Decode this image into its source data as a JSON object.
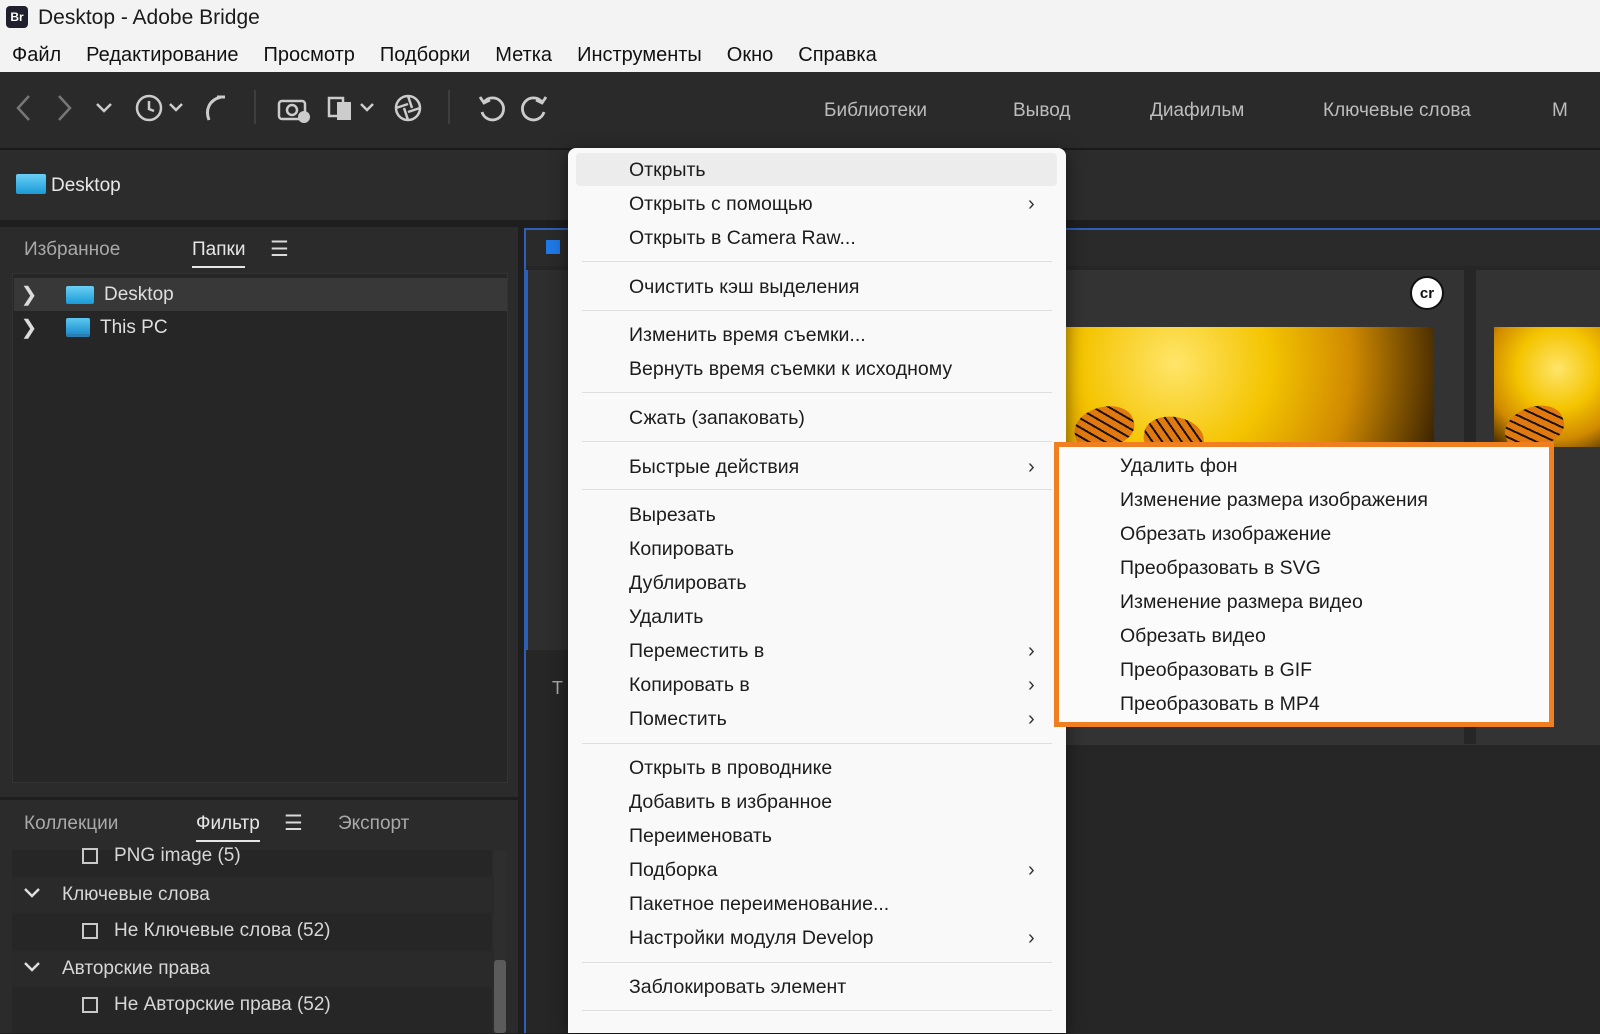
{
  "window": {
    "app_badge": "Br",
    "title": "Desktop - Adobe Bridge"
  },
  "menubar": [
    "Файл",
    "Редактирование",
    "Просмотр",
    "Подборки",
    "Метка",
    "Инструменты",
    "Окно",
    "Справка"
  ],
  "toolbar": {
    "icons": [
      "back-icon",
      "forward-icon",
      "chevron-down-icon",
      "history-icon",
      "boomerang-icon",
      "camera-import-icon",
      "copy-stack-icon",
      "photoshop-icon",
      "rotate-left-icon",
      "rotate-right-icon"
    ],
    "workspaces": [
      "Библиотеки",
      "Вывод",
      "Диафильм",
      "Ключевые слова",
      "М"
    ]
  },
  "pathbar": {
    "label": "Desktop"
  },
  "left_top": {
    "tabs": [
      "Избранное",
      "Папки"
    ],
    "active_tab": "Папки",
    "tree": [
      {
        "label": "Desktop",
        "selected": true,
        "icon": "folder-icon"
      },
      {
        "label": "This PC",
        "selected": false,
        "icon": "pc-icon"
      }
    ]
  },
  "left_bottom": {
    "tabs": [
      "Коллекции",
      "Фильтр",
      "Экспорт"
    ],
    "active_tab": "Фильтр",
    "rows": [
      {
        "type": "checkbox",
        "label": "PNG image  (5)"
      },
      {
        "type": "group",
        "label": "Ключевые слова"
      },
      {
        "type": "checkbox",
        "label": "Не Ключевые слова  (52)"
      },
      {
        "type": "group",
        "label": "Авторские права"
      },
      {
        "type": "checkbox",
        "label": "Не Авторские права  (52)"
      }
    ]
  },
  "content": {
    "peek_text": "Т",
    "badge": "cr"
  },
  "context_menu": {
    "items": [
      {
        "label": "Открыть",
        "submenu": false
      },
      {
        "label": "Открыть с помощью",
        "submenu": true
      },
      {
        "label": "Открыть в Camera Raw...",
        "submenu": false
      },
      {
        "label": "Очистить кэш выделения",
        "submenu": false
      },
      {
        "label": "Изменить время съемки...",
        "submenu": false
      },
      {
        "label": "Вернуть время съемки к исходному",
        "submenu": false
      },
      {
        "label": "Сжать (запаковать)",
        "submenu": false
      },
      {
        "label": "Быстрые действия",
        "submenu": true
      },
      {
        "label": "Вырезать",
        "submenu": false
      },
      {
        "label": "Копировать",
        "submenu": false
      },
      {
        "label": "Дублировать",
        "submenu": false
      },
      {
        "label": "Удалить",
        "submenu": false
      },
      {
        "label": "Переместить в",
        "submenu": true
      },
      {
        "label": "Копировать в",
        "submenu": true
      },
      {
        "label": "Поместить",
        "submenu": true
      },
      {
        "label": "Открыть в проводнике",
        "submenu": false
      },
      {
        "label": "Добавить в избранное",
        "submenu": false
      },
      {
        "label": "Переименовать",
        "submenu": false
      },
      {
        "label": "Подборка",
        "submenu": true
      },
      {
        "label": "Пакетное переименование...",
        "submenu": false
      },
      {
        "label": "Настройки модуля Develop",
        "submenu": true
      },
      {
        "label": "Заблокировать элемент",
        "submenu": false
      }
    ]
  },
  "quick_actions_submenu": {
    "highlight_color": "#f07f22",
    "items": [
      "Удалить фон",
      "Изменение размера изображения",
      "Обрезать изображение",
      "Преобразовать в SVG",
      "Изменение размера видео",
      "Обрезать видео",
      "Преобразовать в GIF",
      "Преобразовать в MP4"
    ]
  }
}
